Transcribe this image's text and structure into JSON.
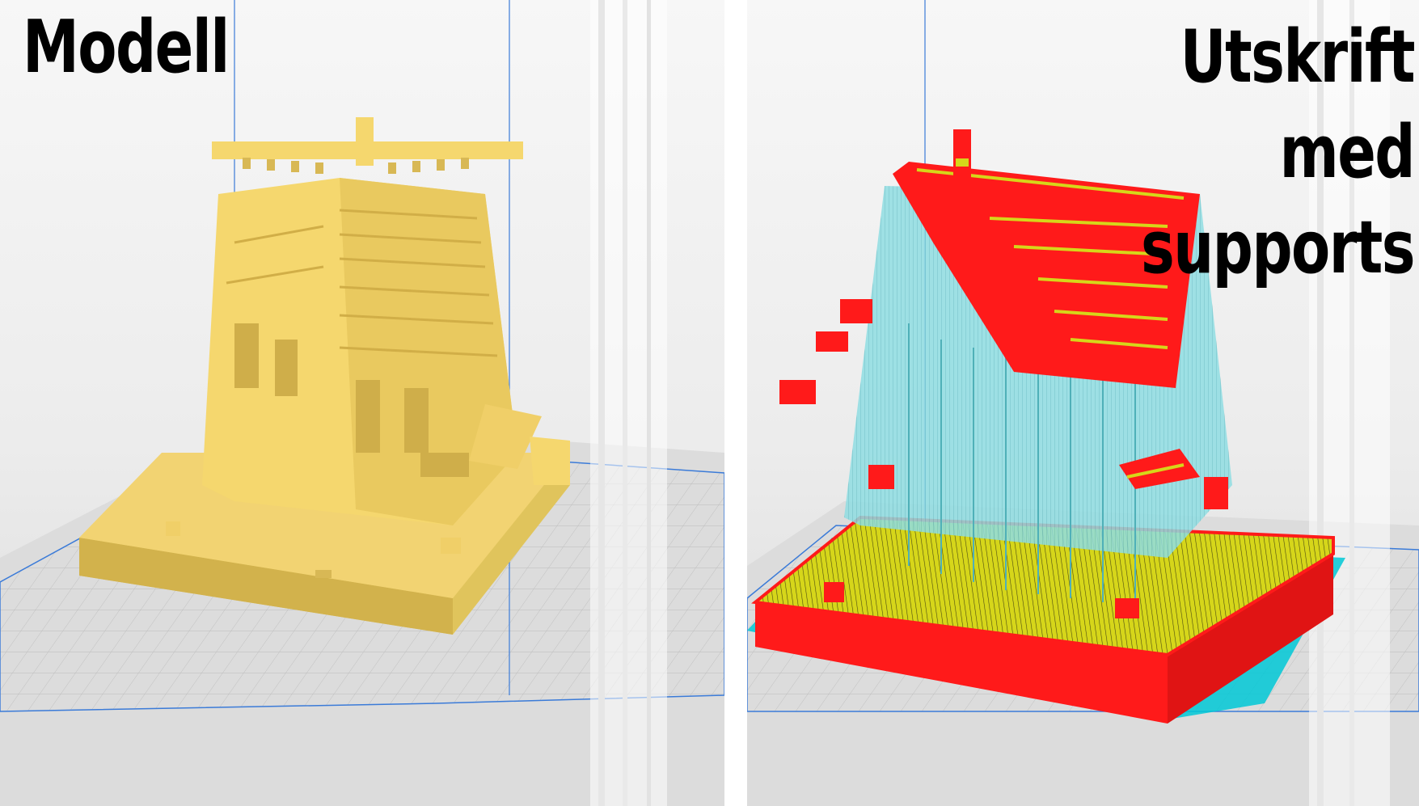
{
  "left_panel": {
    "title": "Modell"
  },
  "right_panel": {
    "title": "Utskrift med supports"
  },
  "colors": {
    "model_yellow": "#f5d76e",
    "model_yellow_shadow": "#c9a93e",
    "wall_red": "#ff1a1a",
    "infill_yellow": "#d6d61a",
    "support_cyan": "#7fd3d9",
    "brim_cyan": "#00c8d6",
    "grid_line": "#b9b9b9",
    "build_volume_blue": "#3b7bd8",
    "background_light": "#f2f2f2"
  }
}
